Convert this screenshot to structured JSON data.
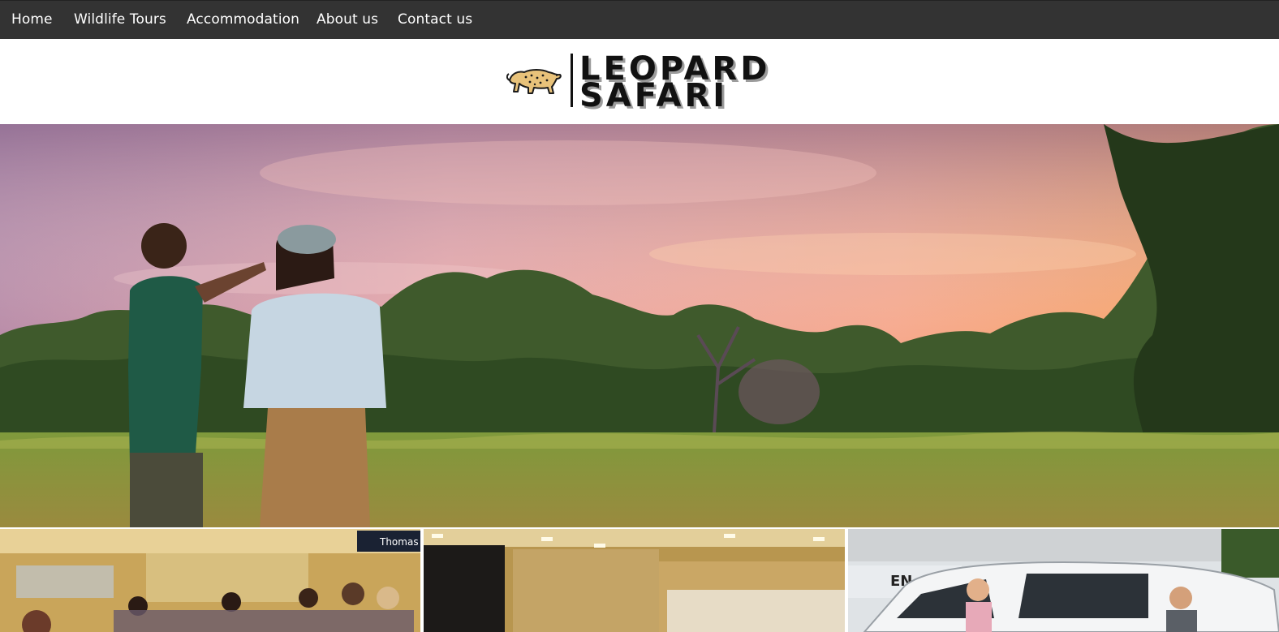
{
  "nav": {
    "items": [
      {
        "label": "Home"
      },
      {
        "label": "Wildlife Tours"
      },
      {
        "label": "Accommodation"
      },
      {
        "label": "About us"
      },
      {
        "label": "Contact us"
      }
    ]
  },
  "logo": {
    "line1": "LEOPARD",
    "line2": "SAFARI",
    "icon": "leopard-icon"
  },
  "hero": {
    "image": "safari-guide-pointing-at-sunset"
  },
  "gallery": {
    "images": [
      {
        "name": "airport-group-photo",
        "sign_text": "Thomas Cook"
      },
      {
        "name": "airport-terminal-photo"
      },
      {
        "name": "safari-van-photo",
        "sign_text": "EN"
      }
    ]
  },
  "colors": {
    "nav_bg": "#333333",
    "nav_text": "#ffffff",
    "logo_text": "#111111"
  }
}
